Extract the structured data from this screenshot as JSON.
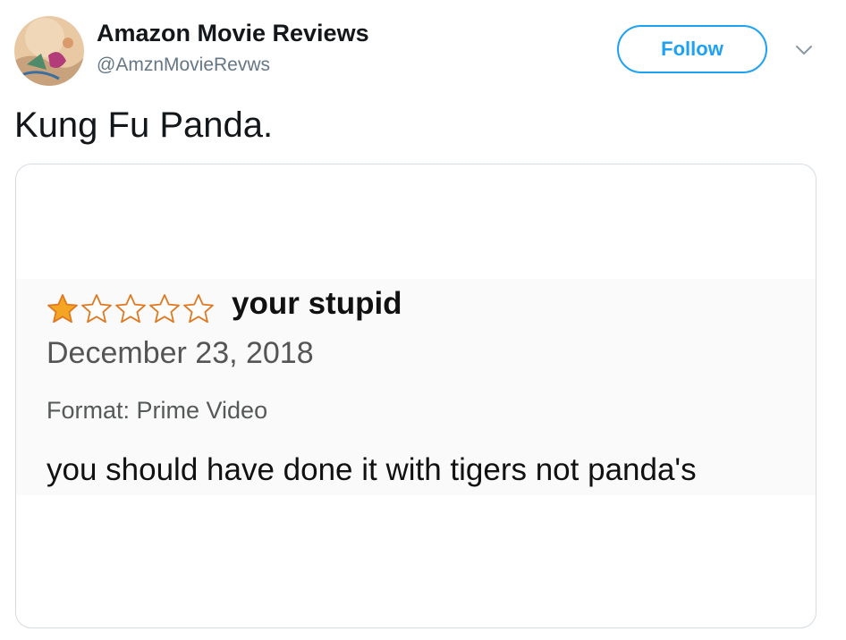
{
  "tweet": {
    "author_name": "Amazon Movie Reviews",
    "author_handle": "@AmznMovieRevws",
    "follow_label": "Follow",
    "text": "Kung Fu Panda."
  },
  "review": {
    "rating": 1,
    "rating_max": 5,
    "title": "your stupid",
    "date": "December 23, 2018",
    "format": "Format: Prime Video",
    "body": "you should have done it with tigers not panda's"
  },
  "colors": {
    "accent": "#1da1f2",
    "star_fill": "#f4a622",
    "star_outline": "#de7921"
  },
  "icons": {
    "caret": "chevron-down-icon",
    "star_filled": "star-filled-icon",
    "star_empty": "star-empty-icon"
  }
}
